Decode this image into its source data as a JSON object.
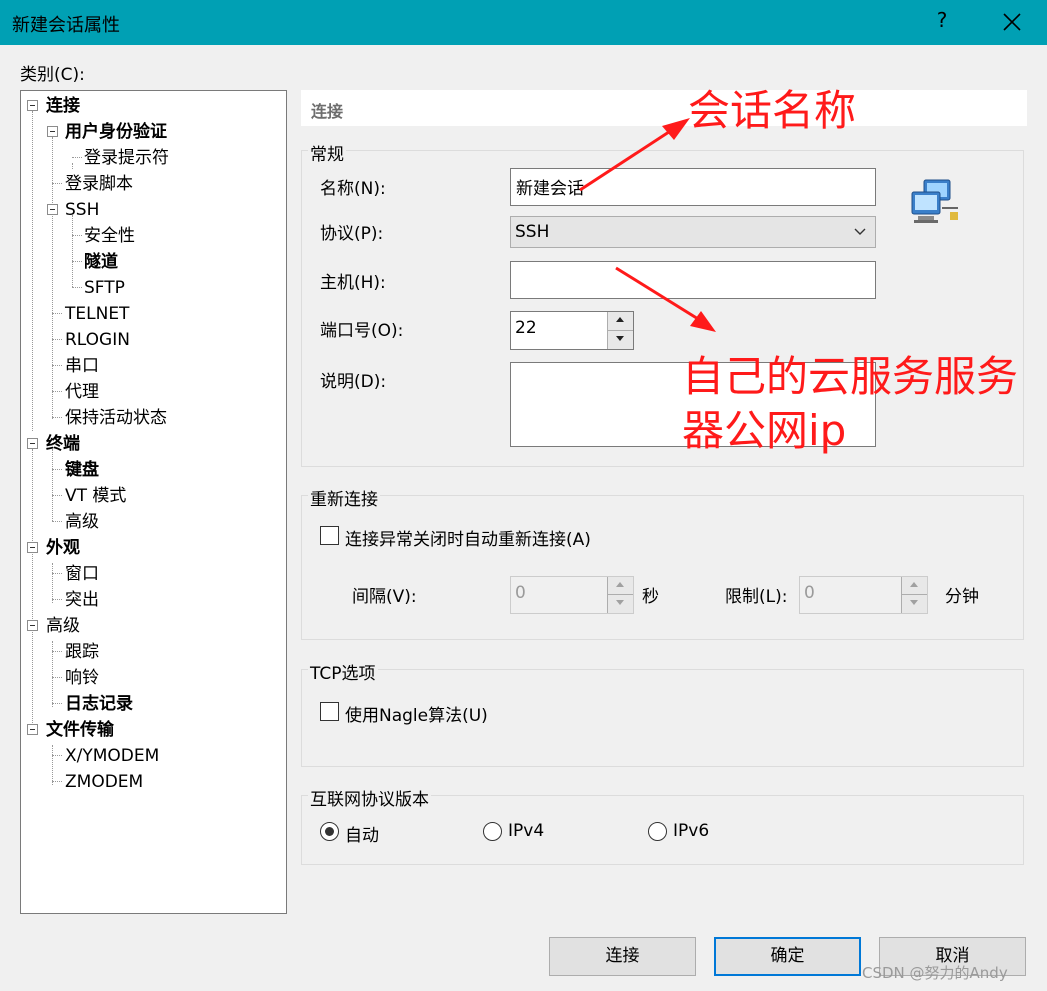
{
  "window": {
    "title": "新建会话属性",
    "help_label": "?",
    "close_label": "✕"
  },
  "category_label": "类别(C):",
  "tree": {
    "items": [
      {
        "label": "连接",
        "bold": true
      },
      {
        "label": "用户身份验证",
        "bold": true
      },
      {
        "label": "登录提示符",
        "bold": false
      },
      {
        "label": "登录脚本",
        "bold": false
      },
      {
        "label": "SSH",
        "bold": false
      },
      {
        "label": "安全性",
        "bold": false
      },
      {
        "label": "隧道",
        "bold": true
      },
      {
        "label": "SFTP",
        "bold": false
      },
      {
        "label": "TELNET",
        "bold": false
      },
      {
        "label": "RLOGIN",
        "bold": false
      },
      {
        "label": "串口",
        "bold": false
      },
      {
        "label": "代理",
        "bold": false
      },
      {
        "label": "保持活动状态",
        "bold": false
      },
      {
        "label": "终端",
        "bold": true
      },
      {
        "label": "键盘",
        "bold": true
      },
      {
        "label": "VT 模式",
        "bold": false
      },
      {
        "label": "高级",
        "bold": false
      },
      {
        "label": "外观",
        "bold": true
      },
      {
        "label": "窗口",
        "bold": false
      },
      {
        "label": "突出",
        "bold": false
      },
      {
        "label": "高级",
        "bold": false
      },
      {
        "label": "跟踪",
        "bold": false
      },
      {
        "label": "响铃",
        "bold": false
      },
      {
        "label": "日志记录",
        "bold": true
      },
      {
        "label": "文件传输",
        "bold": true
      },
      {
        "label": "X/YMODEM",
        "bold": false
      },
      {
        "label": "ZMODEM",
        "bold": false
      }
    ]
  },
  "section_title": "连接",
  "general": {
    "group_title": "常规",
    "name_label": "名称(N):",
    "name_value": "新建会话",
    "protocol_label": "协议(P):",
    "protocol_value": "SSH",
    "host_label": "主机(H):",
    "host_value": "",
    "port_label": "端口号(O):",
    "port_value": "22",
    "desc_label": "说明(D):",
    "desc_value": "",
    "icon": "network-computers-icon"
  },
  "reconnect": {
    "group_title": "重新连接",
    "checkbox_label": "连接异常关闭时自动重新连接(A)",
    "interval_label": "间隔(V):",
    "interval_value": "0",
    "interval_unit": "秒",
    "limit_label": "限制(L):",
    "limit_value": "0",
    "limit_unit": "分钟"
  },
  "tcp": {
    "group_title": "TCP选项",
    "nagle_label": "使用Nagle算法(U)"
  },
  "ipver": {
    "group_title": "互联网协议版本",
    "options": [
      "自动",
      "IPv4",
      "IPv6"
    ],
    "selected": "自动"
  },
  "buttons": {
    "connect": "连接",
    "ok": "确定",
    "cancel": "取消"
  },
  "annotations": {
    "session_name": "会话名称",
    "host_hint_line1": "自己的云服务服务",
    "host_hint_line2": "器公网ip",
    "color": "#ff1a1a"
  },
  "watermark": "CSDN @努力的Andy",
  "colors": {
    "titlebar": "#00a0b4",
    "default_button_border": "#0078d7"
  }
}
